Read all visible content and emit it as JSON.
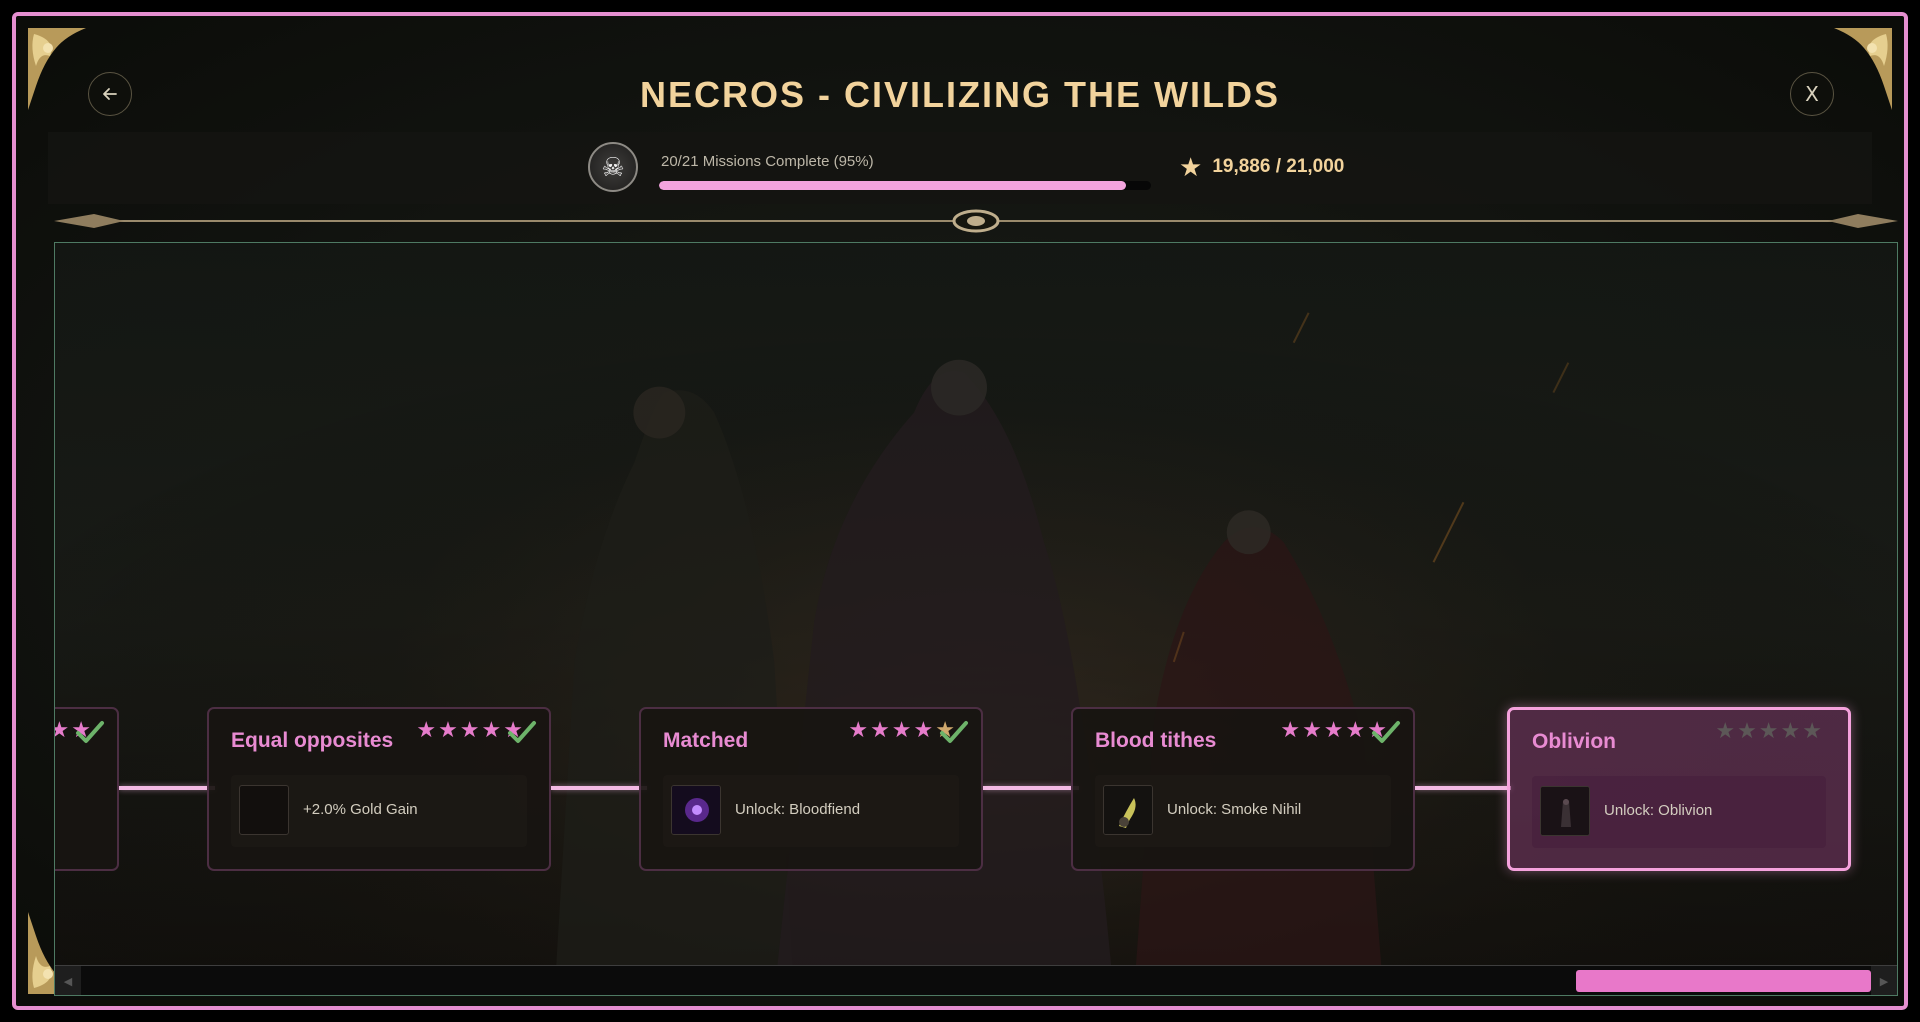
{
  "header": {
    "title": "NECROS - CIVILIZING THE WILDS",
    "back_icon": "arrow-left-icon",
    "close_label": "X"
  },
  "progress": {
    "missions_text": "20/21 Missions Complete (95%)",
    "fraction": 0.95,
    "stars_text": "19,886 / 21,000",
    "emblem_icon": "skull-icon"
  },
  "missions": [
    {
      "title": "",
      "stars_earned": 5,
      "completed": true,
      "reward": ""
    },
    {
      "title": "Equal opposites",
      "stars_earned": 5,
      "completed": true,
      "reward": "+2.0% Gold Gain"
    },
    {
      "title": "Matched",
      "stars_earned": 4,
      "completed": true,
      "reward": "Unlock: Bloodfiend"
    },
    {
      "title": "Blood tithes",
      "stars_earned": 5,
      "completed": true,
      "reward": "Unlock: Smoke Nihil"
    },
    {
      "title": "Oblivion",
      "stars_earned": 0,
      "completed": false,
      "reward": "Unlock: Oblivion"
    }
  ],
  "scrollbar": {
    "position_fraction": 1.0
  },
  "colors": {
    "accent_pink": "#e88bd2",
    "title_gold": "#f2d39c",
    "check_green": "#6db36a",
    "frame_border": "#e58fd0"
  }
}
